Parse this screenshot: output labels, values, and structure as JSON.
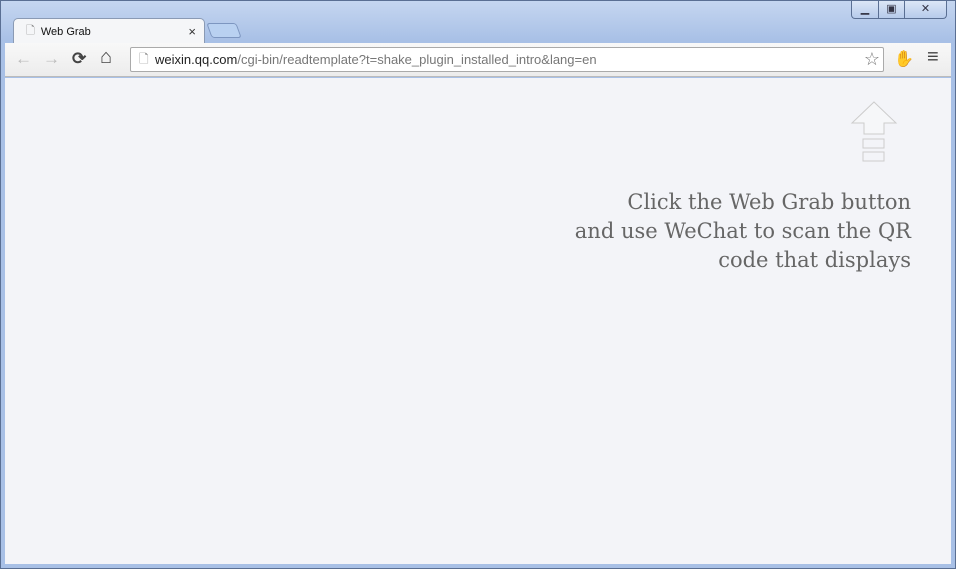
{
  "window": {
    "controls": [
      "minimize",
      "maximize",
      "close"
    ]
  },
  "tab": {
    "title": "Web Grab",
    "close": "×"
  },
  "toolbar": {
    "back": "←",
    "forward": "→",
    "reload": "⟳",
    "home": "⌂",
    "menu": "≡"
  },
  "address": {
    "host": "weixin.qq.com",
    "path": "/cgi-bin/readtemplate?t=shake_plugin_installed_intro&lang=en"
  },
  "page": {
    "lines": [
      "Click the Web Grab button",
      "and use WeChat to scan the QR",
      "code that displays"
    ]
  }
}
